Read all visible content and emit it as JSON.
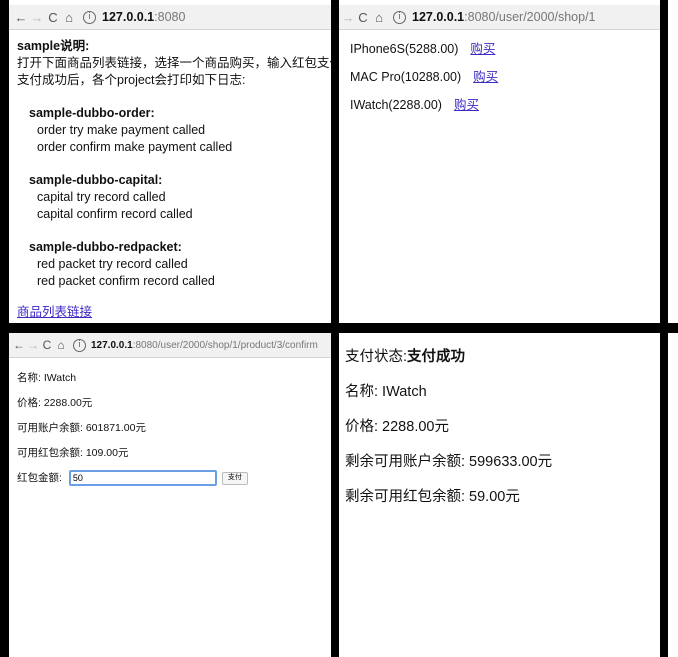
{
  "panel1": {
    "address": {
      "host": "127.0.0.1",
      "path": ":8080"
    },
    "heading": "sample说明:",
    "intro_line1": "打开下面商品列表链接，选择一个商品购买，输入红包支付，",
    "intro_line2": "支付成功后，各个project会打印如下日志:",
    "modules": [
      {
        "name": "sample-dubbo-order:",
        "lines": [
          "order try make payment called",
          "order confirm make payment called"
        ]
      },
      {
        "name": "sample-dubbo-capital:",
        "lines": [
          "capital try record called",
          "capital confirm record called"
        ]
      },
      {
        "name": "sample-dubbo-redpacket:",
        "lines": [
          "red packet try record called",
          "red packet confirm record called"
        ]
      }
    ],
    "link_text": "商品列表链接"
  },
  "panel2": {
    "address": {
      "host": "127.0.0.1",
      "path": ":8080/user/2000/shop/1"
    },
    "products": [
      {
        "name": "IPhone6S(5288.00)",
        "buy": "购买"
      },
      {
        "name": "MAC Pro(10288.00)",
        "buy": "购买"
      },
      {
        "name": "IWatch(2288.00)",
        "buy": "购买"
      }
    ]
  },
  "panel3": {
    "address": {
      "host": "127.0.0.1",
      "path": ":8080/user/2000/shop/1/product/3/confirm"
    },
    "name_label": "名称: IWatch",
    "price_label": "价格: 2288.00元",
    "balance_label": "可用账户余额: 601871.00元",
    "redpacket_label": "可用红包余额: 109.00元",
    "amount_label": "红包金额:",
    "amount_value": "50",
    "pay_button": "支付"
  },
  "panel4": {
    "status_label": "支付状态:",
    "status_value": "支付成功",
    "name_line": "名称: IWatch",
    "price_line": "价格: 2288.00元",
    "balance_line": "剩余可用账户余额: 599633.00元",
    "redpacket_line": "剩余可用红包余额: 59.00元"
  },
  "icons": [
    "back-arrow-icon",
    "forward-arrow-icon",
    "reload-icon",
    "home-icon",
    "info-icon"
  ]
}
